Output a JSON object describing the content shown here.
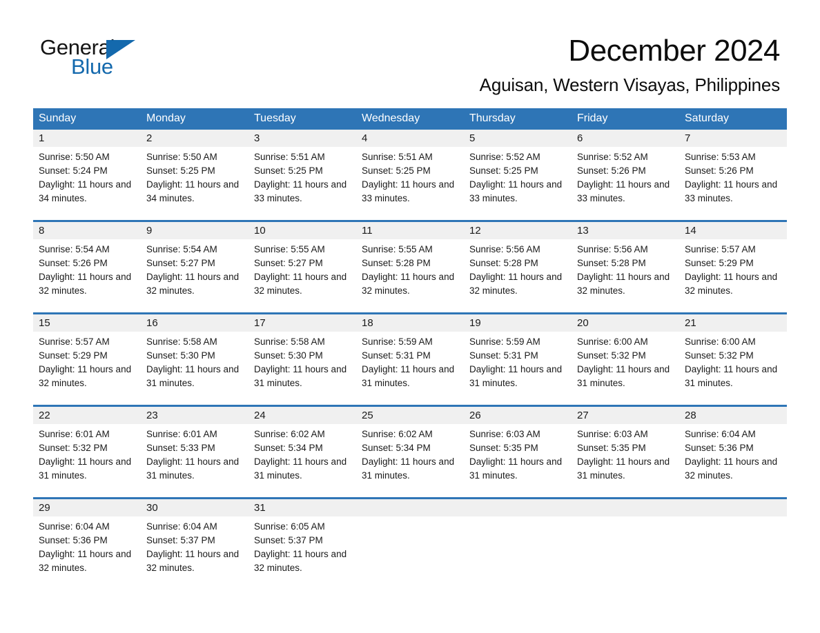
{
  "brand": {
    "name_part1": "General",
    "name_part2": "Blue",
    "triangle_color": "#1469ad",
    "accent_color": "#2e75b6"
  },
  "header": {
    "month_title": "December 2024",
    "location": "Aguisan, Western Visayas, Philippines"
  },
  "calendar": {
    "weekday_headers": [
      "Sunday",
      "Monday",
      "Tuesday",
      "Wednesday",
      "Thursday",
      "Friday",
      "Saturday"
    ],
    "labels": {
      "sunrise_prefix": "Sunrise:",
      "sunset_prefix": "Sunset:",
      "daylight_prefix": "Daylight:"
    },
    "weeks": [
      [
        {
          "day": "1",
          "sunrise": "Sunrise: 5:50 AM",
          "sunset": "Sunset: 5:24 PM",
          "daylight": "Daylight: 11 hours and 34 minutes."
        },
        {
          "day": "2",
          "sunrise": "Sunrise: 5:50 AM",
          "sunset": "Sunset: 5:25 PM",
          "daylight": "Daylight: 11 hours and 34 minutes."
        },
        {
          "day": "3",
          "sunrise": "Sunrise: 5:51 AM",
          "sunset": "Sunset: 5:25 PM",
          "daylight": "Daylight: 11 hours and 33 minutes."
        },
        {
          "day": "4",
          "sunrise": "Sunrise: 5:51 AM",
          "sunset": "Sunset: 5:25 PM",
          "daylight": "Daylight: 11 hours and 33 minutes."
        },
        {
          "day": "5",
          "sunrise": "Sunrise: 5:52 AM",
          "sunset": "Sunset: 5:25 PM",
          "daylight": "Daylight: 11 hours and 33 minutes."
        },
        {
          "day": "6",
          "sunrise": "Sunrise: 5:52 AM",
          "sunset": "Sunset: 5:26 PM",
          "daylight": "Daylight: 11 hours and 33 minutes."
        },
        {
          "day": "7",
          "sunrise": "Sunrise: 5:53 AM",
          "sunset": "Sunset: 5:26 PM",
          "daylight": "Daylight: 11 hours and 33 minutes."
        }
      ],
      [
        {
          "day": "8",
          "sunrise": "Sunrise: 5:54 AM",
          "sunset": "Sunset: 5:26 PM",
          "daylight": "Daylight: 11 hours and 32 minutes."
        },
        {
          "day": "9",
          "sunrise": "Sunrise: 5:54 AM",
          "sunset": "Sunset: 5:27 PM",
          "daylight": "Daylight: 11 hours and 32 minutes."
        },
        {
          "day": "10",
          "sunrise": "Sunrise: 5:55 AM",
          "sunset": "Sunset: 5:27 PM",
          "daylight": "Daylight: 11 hours and 32 minutes."
        },
        {
          "day": "11",
          "sunrise": "Sunrise: 5:55 AM",
          "sunset": "Sunset: 5:28 PM",
          "daylight": "Daylight: 11 hours and 32 minutes."
        },
        {
          "day": "12",
          "sunrise": "Sunrise: 5:56 AM",
          "sunset": "Sunset: 5:28 PM",
          "daylight": "Daylight: 11 hours and 32 minutes."
        },
        {
          "day": "13",
          "sunrise": "Sunrise: 5:56 AM",
          "sunset": "Sunset: 5:28 PM",
          "daylight": "Daylight: 11 hours and 32 minutes."
        },
        {
          "day": "14",
          "sunrise": "Sunrise: 5:57 AM",
          "sunset": "Sunset: 5:29 PM",
          "daylight": "Daylight: 11 hours and 32 minutes."
        }
      ],
      [
        {
          "day": "15",
          "sunrise": "Sunrise: 5:57 AM",
          "sunset": "Sunset: 5:29 PM",
          "daylight": "Daylight: 11 hours and 32 minutes."
        },
        {
          "day": "16",
          "sunrise": "Sunrise: 5:58 AM",
          "sunset": "Sunset: 5:30 PM",
          "daylight": "Daylight: 11 hours and 31 minutes."
        },
        {
          "day": "17",
          "sunrise": "Sunrise: 5:58 AM",
          "sunset": "Sunset: 5:30 PM",
          "daylight": "Daylight: 11 hours and 31 minutes."
        },
        {
          "day": "18",
          "sunrise": "Sunrise: 5:59 AM",
          "sunset": "Sunset: 5:31 PM",
          "daylight": "Daylight: 11 hours and 31 minutes."
        },
        {
          "day": "19",
          "sunrise": "Sunrise: 5:59 AM",
          "sunset": "Sunset: 5:31 PM",
          "daylight": "Daylight: 11 hours and 31 minutes."
        },
        {
          "day": "20",
          "sunrise": "Sunrise: 6:00 AM",
          "sunset": "Sunset: 5:32 PM",
          "daylight": "Daylight: 11 hours and 31 minutes."
        },
        {
          "day": "21",
          "sunrise": "Sunrise: 6:00 AM",
          "sunset": "Sunset: 5:32 PM",
          "daylight": "Daylight: 11 hours and 31 minutes."
        }
      ],
      [
        {
          "day": "22",
          "sunrise": "Sunrise: 6:01 AM",
          "sunset": "Sunset: 5:32 PM",
          "daylight": "Daylight: 11 hours and 31 minutes."
        },
        {
          "day": "23",
          "sunrise": "Sunrise: 6:01 AM",
          "sunset": "Sunset: 5:33 PM",
          "daylight": "Daylight: 11 hours and 31 minutes."
        },
        {
          "day": "24",
          "sunrise": "Sunrise: 6:02 AM",
          "sunset": "Sunset: 5:34 PM",
          "daylight": "Daylight: 11 hours and 31 minutes."
        },
        {
          "day": "25",
          "sunrise": "Sunrise: 6:02 AM",
          "sunset": "Sunset: 5:34 PM",
          "daylight": "Daylight: 11 hours and 31 minutes."
        },
        {
          "day": "26",
          "sunrise": "Sunrise: 6:03 AM",
          "sunset": "Sunset: 5:35 PM",
          "daylight": "Daylight: 11 hours and 31 minutes."
        },
        {
          "day": "27",
          "sunrise": "Sunrise: 6:03 AM",
          "sunset": "Sunset: 5:35 PM",
          "daylight": "Daylight: 11 hours and 31 minutes."
        },
        {
          "day": "28",
          "sunrise": "Sunrise: 6:04 AM",
          "sunset": "Sunset: 5:36 PM",
          "daylight": "Daylight: 11 hours and 32 minutes."
        }
      ],
      [
        {
          "day": "29",
          "sunrise": "Sunrise: 6:04 AM",
          "sunset": "Sunset: 5:36 PM",
          "daylight": "Daylight: 11 hours and 32 minutes."
        },
        {
          "day": "30",
          "sunrise": "Sunrise: 6:04 AM",
          "sunset": "Sunset: 5:37 PM",
          "daylight": "Daylight: 11 hours and 32 minutes."
        },
        {
          "day": "31",
          "sunrise": "Sunrise: 6:05 AM",
          "sunset": "Sunset: 5:37 PM",
          "daylight": "Daylight: 11 hours and 32 minutes."
        },
        {
          "day": "",
          "sunrise": "",
          "sunset": "",
          "daylight": ""
        },
        {
          "day": "",
          "sunrise": "",
          "sunset": "",
          "daylight": ""
        },
        {
          "day": "",
          "sunrise": "",
          "sunset": "",
          "daylight": ""
        },
        {
          "day": "",
          "sunrise": "",
          "sunset": "",
          "daylight": ""
        }
      ]
    ]
  }
}
